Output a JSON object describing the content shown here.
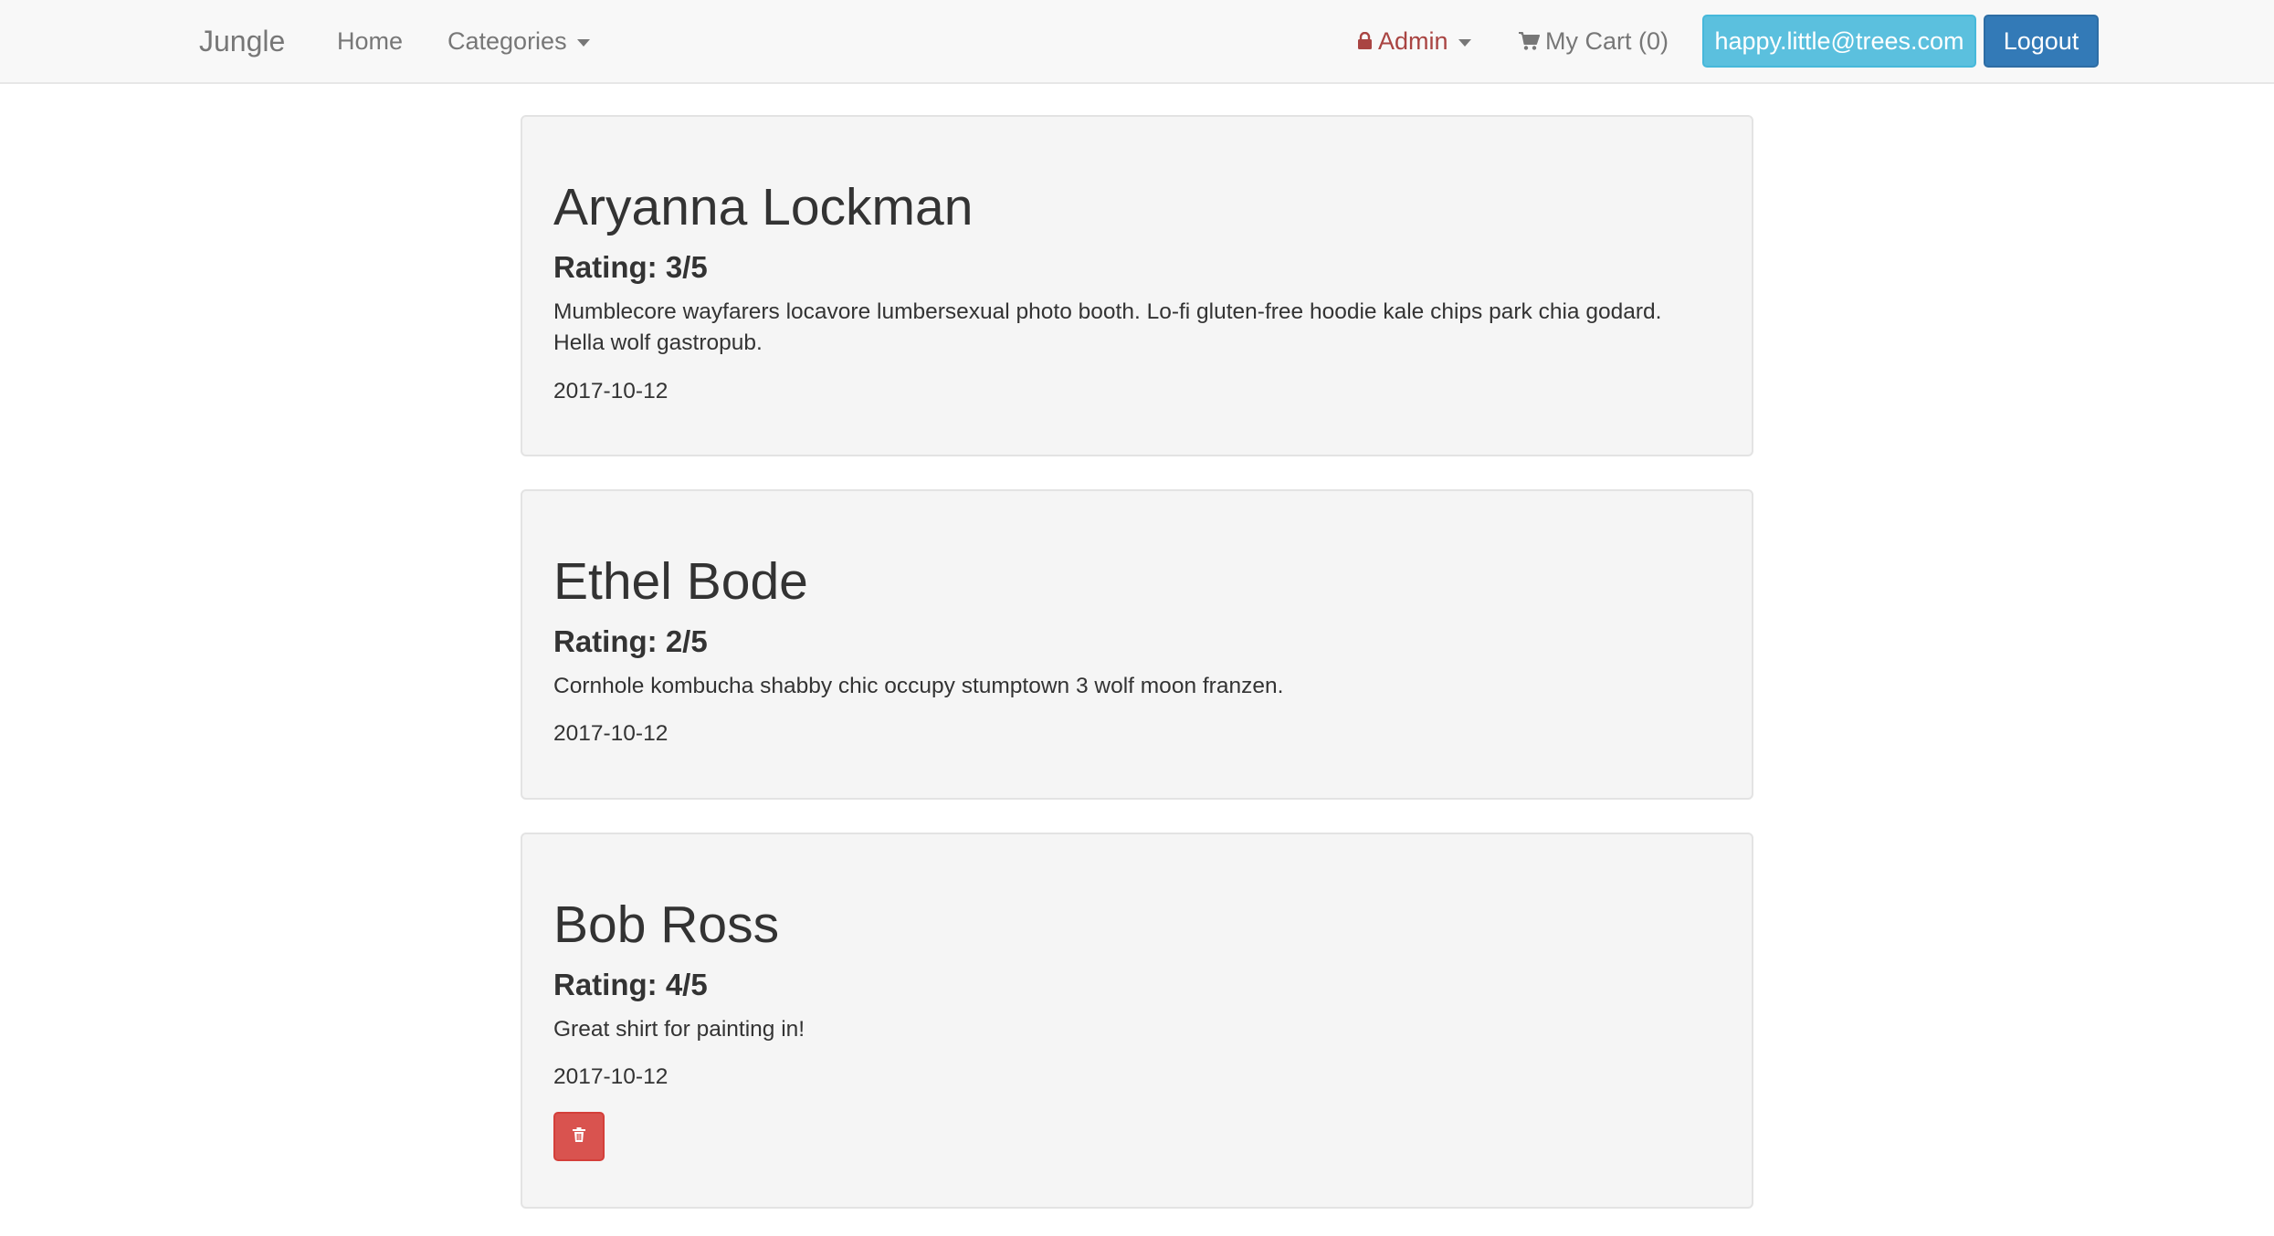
{
  "navbar": {
    "brand": "Jungle",
    "home": "Home",
    "categories": "Categories",
    "admin": "Admin",
    "cart": "My Cart (0)",
    "user_email": "happy.little@trees.com",
    "logout": "Logout"
  },
  "icons": {
    "admin": "lock-icon",
    "cart": "shopping-cart-icon",
    "delete": "trash-icon"
  },
  "colors": {
    "admin_text": "#a94442",
    "user_button": "#5bc0de",
    "logout_button": "#337ab7",
    "delete_button": "#d9534f"
  },
  "reviews": [
    {
      "name": "Aryanna Lockman",
      "rating": "Rating: 3/5",
      "body": "Mumblecore wayfarers locavore lumbersexual photo booth. Lo-fi gluten-free hoodie kale chips park chia godard. Hella wolf gastropub.",
      "date": "2017-10-12"
    },
    {
      "name": "Ethel Bode",
      "rating": "Rating: 2/5",
      "body": "Cornhole kombucha shabby chic occupy stumptown 3 wolf moon franzen.",
      "date": "2017-10-12"
    },
    {
      "name": "Bob Ross",
      "rating": "Rating: 4/5",
      "body": "Great shirt for painting in!",
      "date": "2017-10-12"
    }
  ]
}
